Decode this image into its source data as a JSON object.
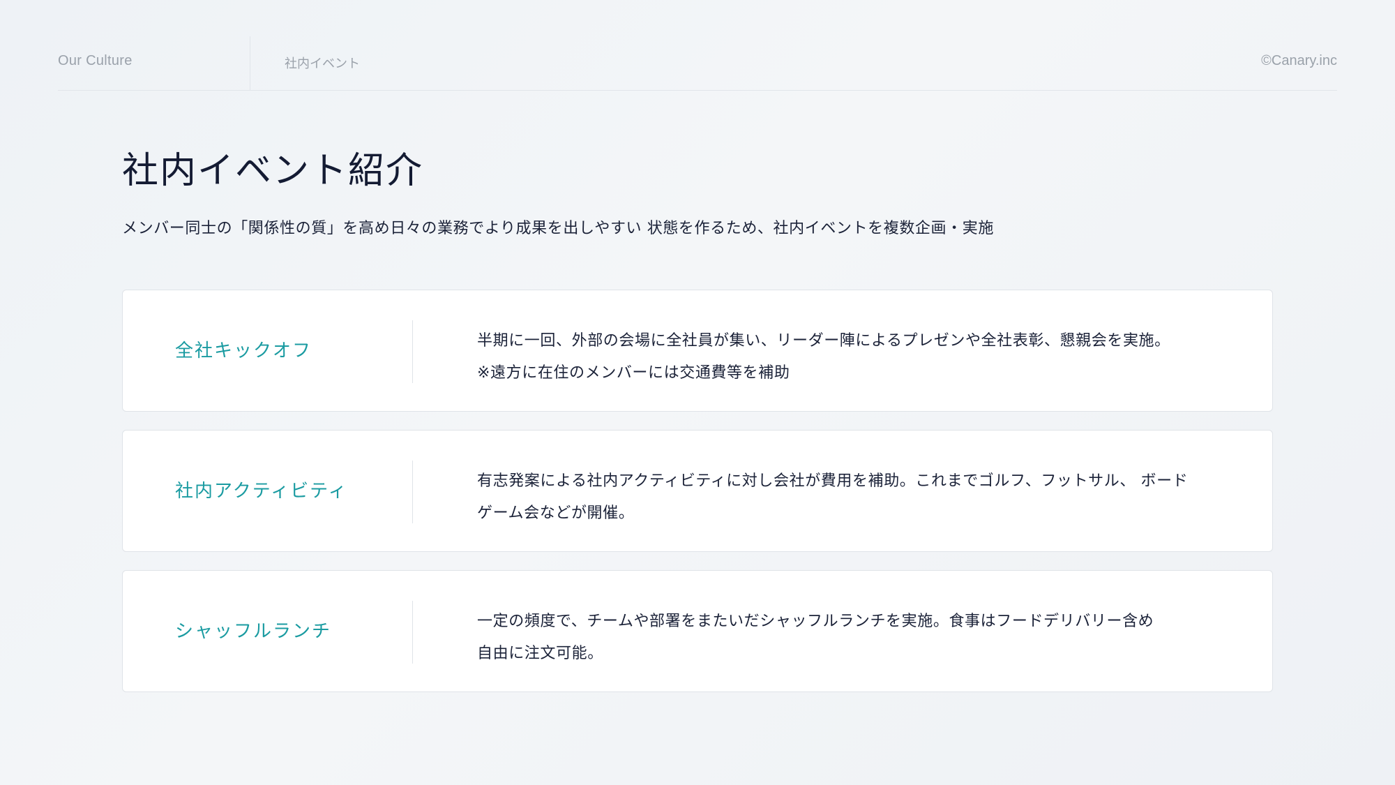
{
  "header": {
    "section": "Our Culture",
    "subsection": "社内イベント",
    "copyright": "©Canary.inc"
  },
  "page": {
    "title": "社内イベント紹介",
    "lead": "メンバー同士の「関係性の質」を高め日々の業務でより成果を出しやすい 状態を作るため、社内イベントを複数企画・実施"
  },
  "events": [
    {
      "title": "全社キックオフ",
      "lines": [
        "半期に一回、外部の会場に全社員が集い、リーダー陣によるプレゼンや全社表彰、懇親会を実施。",
        "※遠方に在住のメンバーには交通費等を補助"
      ]
    },
    {
      "title": "社内アクティビティ",
      "lines": [
        "有志発案による社内アクティビティに対し会社が費用を補助。これまでゴルフ、フットサル、 ボード",
        "ゲーム会などが開催。"
      ]
    },
    {
      "title": "シャッフルランチ",
      "lines": [
        "一定の頻度で、チームや部署をまたいだシャッフルランチを実施。食事はフードデリバリー含め",
        "自由に注文可能。"
      ]
    }
  ],
  "colors": {
    "accent": "#1a9ba1",
    "text": "#1b2238",
    "muted": "#9aa1aa",
    "border": "#dfe3e8"
  }
}
